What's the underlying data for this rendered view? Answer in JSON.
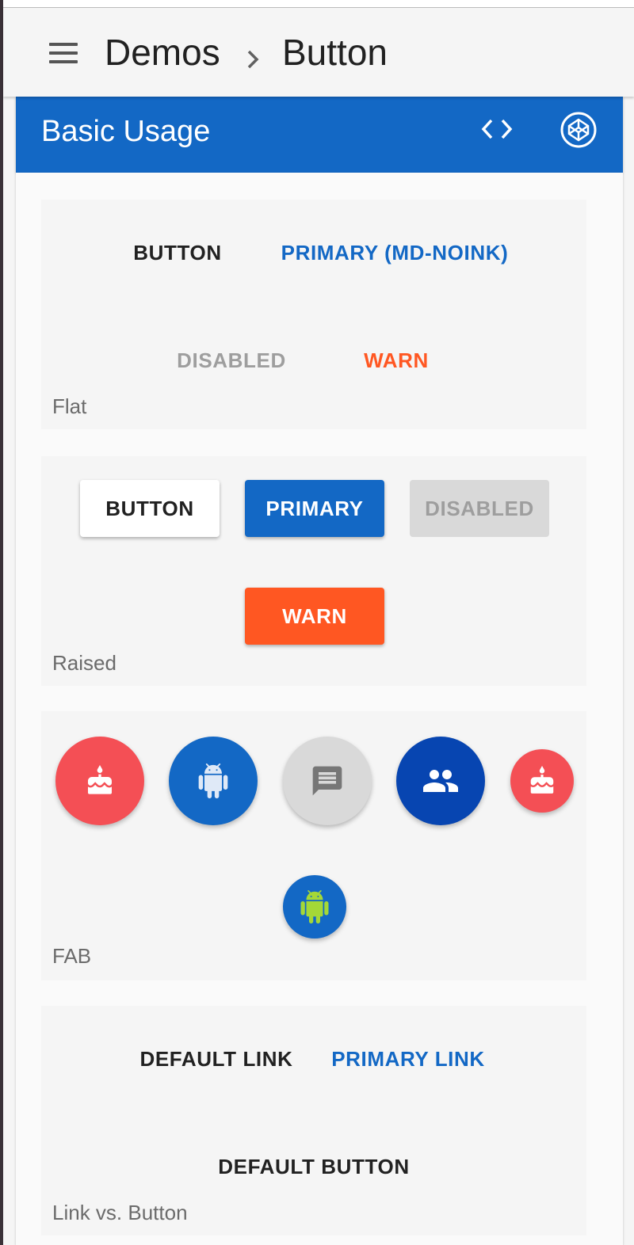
{
  "breadcrumb": {
    "section": "Demos",
    "page": "Button"
  },
  "card": {
    "title": "Basic Usage"
  },
  "flat": {
    "label": "Flat",
    "buttons": {
      "default": "BUTTON",
      "primary_noink": "PRIMARY (MD-NOINK)",
      "disabled": "DISABLED",
      "warn": "WARN"
    }
  },
  "raised": {
    "label": "Raised",
    "buttons": {
      "default": "BUTTON",
      "primary": "PRIMARY",
      "disabled": "DISABLED",
      "warn": "WARN"
    }
  },
  "fab": {
    "label": "FAB",
    "buttons": [
      {
        "icon": "cake-icon",
        "color": "#f44f55"
      },
      {
        "icon": "android-icon",
        "color": "#1368c5"
      },
      {
        "icon": "message-icon",
        "color": "#d9d9d9"
      },
      {
        "icon": "people-icon",
        "color": "#0745b1"
      },
      {
        "icon": "cake-icon",
        "color": "#f44f55",
        "size": "mini"
      },
      {
        "icon": "android-icon",
        "color": "#1368c5",
        "icon_color": "#a4d837",
        "size": "mini"
      }
    ]
  },
  "links": {
    "label": "Link vs. Button",
    "default_link": "DEFAULT LINK",
    "primary_link": "PRIMARY LINK",
    "default_button": "DEFAULT BUTTON"
  },
  "colors": {
    "primary": "#1368c5",
    "warn": "#ff5722",
    "disabled_text": "#9e9e9e",
    "fab_accent": "#f44f55",
    "fab_dark": "#0745b1",
    "android_green": "#a4d837"
  }
}
